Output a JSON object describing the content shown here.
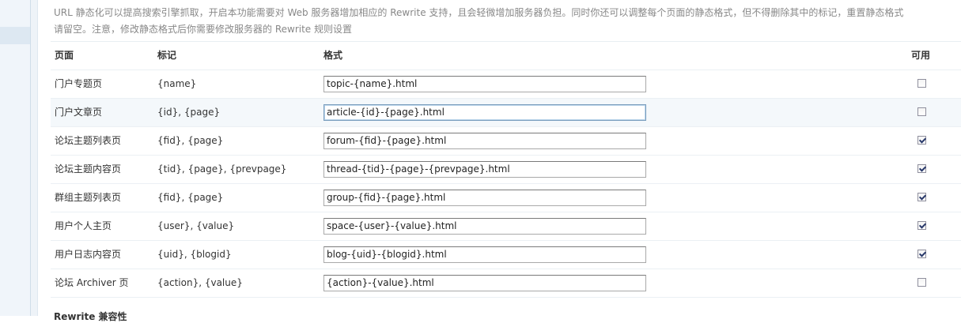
{
  "tips": "URL 静态化可以提高搜索引擎抓取，开启本功能需要对 Web 服务器增加相应的 Rewrite 支持，且会轻微增加服务器负担。同时你还可以调整每个页面的静态格式，但不得删除其中的标记，重置静态格式请留空。注意，修改静态格式后你需要修改服务器的 Rewrite 规则设置",
  "table": {
    "headers": {
      "page": "页面",
      "mark": "标记",
      "format": "格式",
      "available": "可用"
    },
    "rows": [
      {
        "page": "门户专题页",
        "mark": "{name}",
        "format": "topic-{name}.html",
        "enabled": false
      },
      {
        "page": "门户文章页",
        "mark": "{id}, {page}",
        "format": "article-{id}-{page}.html",
        "enabled": false
      },
      {
        "page": "论坛主题列表页",
        "mark": "{fid}, {page}",
        "format": "forum-{fid}-{page}.html",
        "enabled": true
      },
      {
        "page": "论坛主题内容页",
        "mark": "{tid}, {page}, {prevpage}",
        "format": "thread-{tid}-{page}-{prevpage}.html",
        "enabled": true
      },
      {
        "page": "群组主题列表页",
        "mark": "{fid}, {page}",
        "format": "group-{fid}-{page}.html",
        "enabled": true
      },
      {
        "page": "用户个人主页",
        "mark": "{user}, {value}",
        "format": "space-{user}-{value}.html",
        "enabled": true
      },
      {
        "page": "用户日志内容页",
        "mark": "{uid}, {blogid}",
        "format": "blog-{uid}-{blogid}.html",
        "enabled": true
      },
      {
        "page": "论坛 Archiver 页",
        "mark": "{action}, {value}",
        "format": "{action}-{value}.html",
        "enabled": false
      }
    ]
  },
  "next_section_title": "Rewrite 兼容性"
}
